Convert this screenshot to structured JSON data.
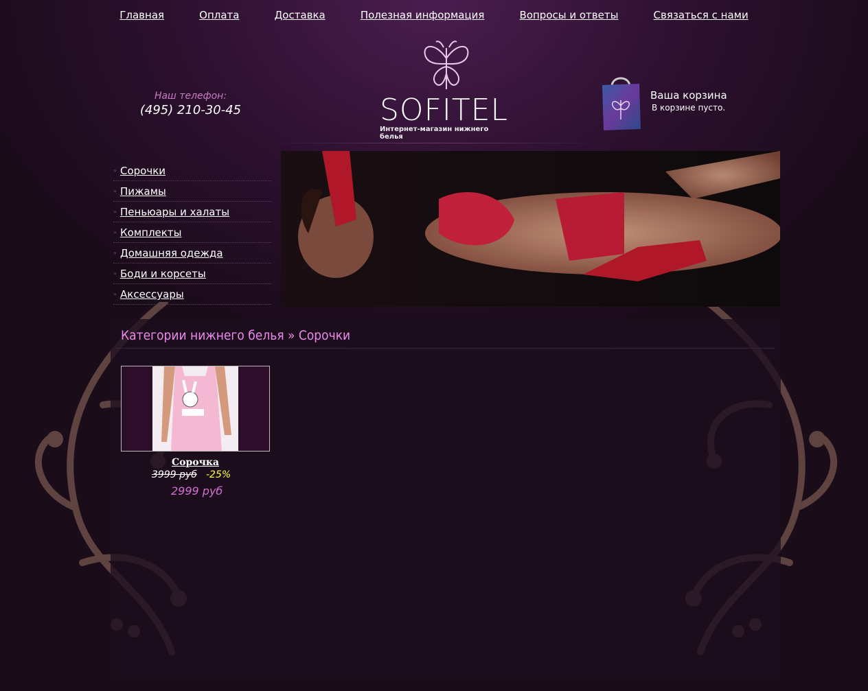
{
  "nav": {
    "items": [
      "Главная",
      "Оплата",
      "Доставка",
      "Полезная информация",
      "Вопросы и ответы",
      "Связаться с нами"
    ]
  },
  "header": {
    "phone_label": "Наш телефон:",
    "phone_number": "(495) 210-30-45",
    "logo_text": "SOFITEL",
    "logo_subtitle": "Интернет-магазин нижнего белья",
    "cart_title": "Ваша корзина",
    "cart_status": "В корзине пусто."
  },
  "sidebar": {
    "items": [
      {
        "label": "Сорочки"
      },
      {
        "label": "Пижамы"
      },
      {
        "label": "Пеньюары и халаты"
      },
      {
        "label": "Комплекты"
      },
      {
        "label": "Домашняя одежда"
      },
      {
        "label": "Боди и корсеты"
      },
      {
        "label": "Аксессуары"
      }
    ]
  },
  "content": {
    "title": "Категории нижнего белья » Сорочки",
    "products": [
      {
        "name": "Сорочка",
        "old_price": "3999 руб",
        "discount": "-25%",
        "price": "2999 руб"
      }
    ]
  },
  "colors": {
    "accent_pink": "#ee88ee",
    "price_pink": "#d36fd3",
    "discount_yellow": "#ffff40",
    "background": "#1a0c19"
  }
}
